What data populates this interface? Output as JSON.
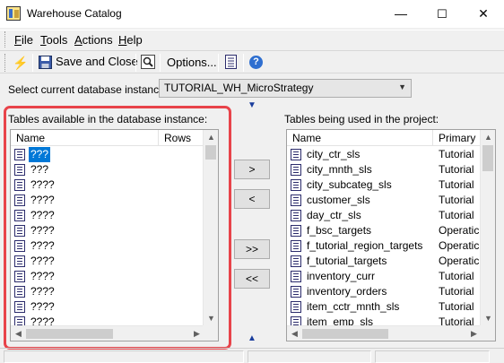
{
  "window": {
    "title": "Warehouse Catalog",
    "minimize": "—",
    "maximize": "☐",
    "close": "✕"
  },
  "menu": [
    {
      "u": "F",
      "rest": "ile"
    },
    {
      "u": "T",
      "rest": "ools"
    },
    {
      "u": "A",
      "rest": "ctions"
    },
    {
      "u": "H",
      "rest": "elp"
    }
  ],
  "toolbar": {
    "save_close": "Save and Close",
    "options": "Options...",
    "lightning_icon": "⚡",
    "help_icon": "?"
  },
  "db": {
    "label": "Select current database instance",
    "selected": "TUTORIAL_WH_MicroStrategy"
  },
  "available": {
    "label": "Tables available in the database instance:",
    "col_name": "Name",
    "col_rows": "Rows",
    "rows": [
      "???",
      "???",
      "????",
      "????",
      "????",
      "????",
      "????",
      "????",
      "????",
      "????",
      "????",
      "????"
    ]
  },
  "used": {
    "label": "Tables being used in the project:",
    "col_name": "Name",
    "col_primary": "Primary",
    "rows": [
      {
        "name": "city_ctr_sls",
        "primary": "Tutorial"
      },
      {
        "name": "city_mnth_sls",
        "primary": "Tutorial"
      },
      {
        "name": "city_subcateg_sls",
        "primary": "Tutorial"
      },
      {
        "name": "customer_sls",
        "primary": "Tutorial"
      },
      {
        "name": "day_ctr_sls",
        "primary": "Tutorial"
      },
      {
        "name": "f_bsc_targets",
        "primary": "Operatic"
      },
      {
        "name": "f_tutorial_region_targets",
        "primary": "Operatic"
      },
      {
        "name": "f_tutorial_targets",
        "primary": "Operatic"
      },
      {
        "name": "inventory_curr",
        "primary": "Tutorial"
      },
      {
        "name": "inventory_orders",
        "primary": "Tutorial"
      },
      {
        "name": "item_cctr_mnth_sls",
        "primary": "Tutorial"
      },
      {
        "name": "item_emp_sls",
        "primary": "Tutorial"
      }
    ]
  },
  "move_buttons": {
    "add": ">",
    "remove": "<",
    "add_all": ">>",
    "remove_all": "<<"
  },
  "colors": {
    "highlight": "#e8434a",
    "selection": "#0078d7",
    "arrow_blue": "#1a3d9c"
  }
}
